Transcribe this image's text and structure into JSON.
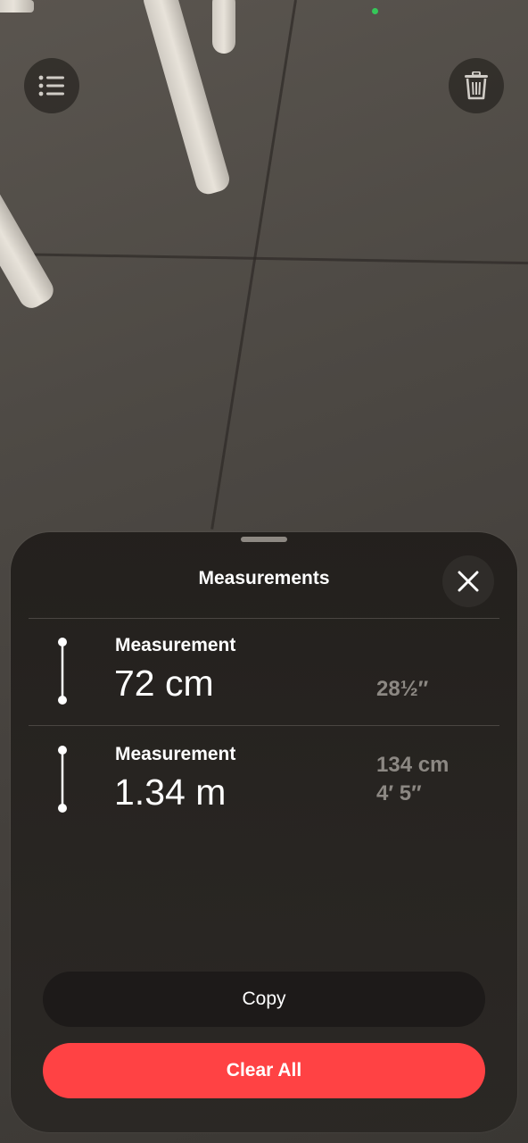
{
  "toolbar": {
    "list_icon": "list-icon",
    "trash_icon": "trash-icon"
  },
  "sheet": {
    "title": "Measurements",
    "close_icon": "close-icon",
    "measurements": [
      {
        "label": "Measurement",
        "value": "72 cm",
        "alt": [
          "28½″"
        ]
      },
      {
        "label": "Measurement",
        "value": "1.34 m",
        "alt": [
          "134 cm",
          "4′ 5″"
        ]
      }
    ],
    "copy_label": "Copy",
    "clear_label": "Clear All"
  },
  "colors": {
    "accent_red": "#ff4244",
    "privacy_indicator": "#35c759"
  }
}
